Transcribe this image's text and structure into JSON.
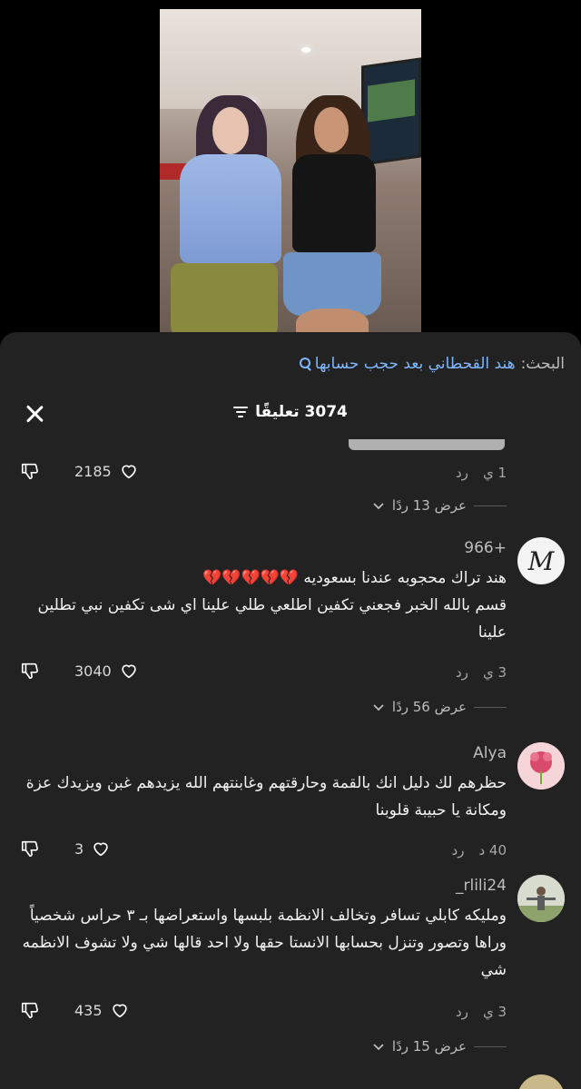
{
  "search": {
    "prefix": "البحث:",
    "query": "هند القحطاني بعد حجب حسابها"
  },
  "header": {
    "count_label": "3074 تعليقًا"
  },
  "comments": [
    {
      "meta_time": "1 ي",
      "reply_label": "رد",
      "likes": "2185",
      "view_replies": "عرض 13 ردًا"
    },
    {
      "user": "966+",
      "line1": "هند تراك محجوبه عندنا بسعوديه 💔💔💔💔💔",
      "line2": "قسم بالله الخبر فجعني تكفين اطلعي طلي علينا اي شى تكفين نبي تطلين علينا",
      "meta_time": "3 ي",
      "reply_label": "رد",
      "likes": "3040",
      "view_replies": "عرض 56 ردًا"
    },
    {
      "user": "Alya",
      "text": "حظرهم لك دليل انك بالقمة وحارقتهم وغابنتهم الله يزيدهم غبن ويزيدك عزة ومكانة يا حبيبة قلوبنا",
      "meta_time": "40 د",
      "reply_label": "رد",
      "likes": "3"
    },
    {
      "user": "_rlili24",
      "text": "ومليكه كابلي تسافر وتخالف الانظمة بلبسها واستعراضها بـ ٣ حراس شخصياً وراها وتصور وتنزل بحسابها الانستا حقها ولا احد قالها شي ولا تشوف الانظمه شي",
      "meta_time": "3 ي",
      "reply_label": "رد",
      "likes": "435",
      "view_replies": "عرض 15 ردًا"
    }
  ],
  "colors": {
    "sheet_bg": "#222222",
    "search_link": "#7fb8ff",
    "muted": "#a8a8a8"
  }
}
